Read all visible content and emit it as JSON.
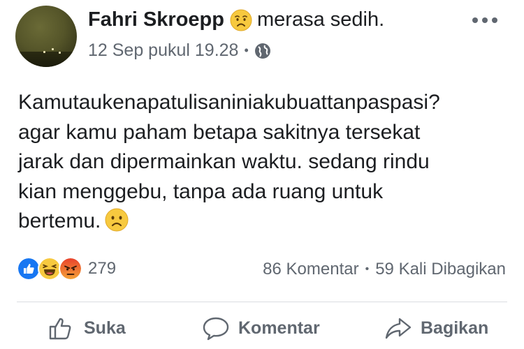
{
  "post": {
    "author": "Fahri Skroepp",
    "feeling_text": "merasa sedih.",
    "feeling_icon": "sad-face-icon",
    "date": "12 Sep pukul 19.28",
    "separator": "•",
    "privacy_icon": "globe-icon",
    "lines": [
      "Kamutaukenapatulisaniniakubuattanpaspasi?",
      "agar kamu paham betapa sakitnya tersekat",
      "jarak dan dipermainkan waktu. sedang rindu",
      "kian menggebu, tanpa ada ruang untuk",
      "bertemu."
    ]
  },
  "reactions": {
    "icons": [
      "like-icon",
      "haha-icon",
      "angry-icon"
    ],
    "count": "279",
    "comments": "86 Komentar",
    "separator": "•",
    "shares": "59 Kali Dibagikan"
  },
  "actions": {
    "like": "Suka",
    "comment": "Komentar",
    "share": "Bagikan"
  },
  "colors": {
    "like_blue": "#1877f2",
    "haha_yellow": "#f7c93f",
    "angry_orange": "#f0612c",
    "text_gray": "#606770"
  }
}
